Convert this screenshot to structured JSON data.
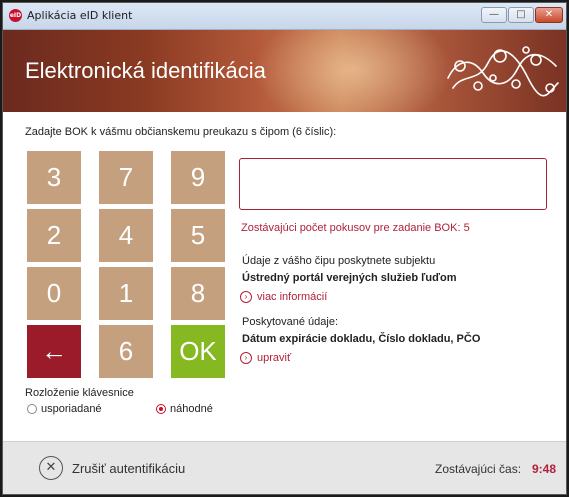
{
  "window": {
    "title": "Aplikácia eID klient",
    "icon_text": "eID",
    "minimize_icon": "minimize-icon",
    "maximize_icon": "maximize-icon",
    "close_icon": "close-icon"
  },
  "banner": {
    "title": "Elektronická identifikácia"
  },
  "instruction": "Zadajte BOK k vášmu občianskemu preukazu s čipom (6 číslic):",
  "keypad": {
    "keys": [
      "3",
      "7",
      "9",
      "2",
      "4",
      "5",
      "0",
      "1",
      "8",
      "←",
      "6",
      "OK"
    ],
    "colors": {
      "digit": "#c4a07f",
      "back": "#9b1b2b",
      "ok": "#86b822"
    }
  },
  "layout": {
    "label": "Rozloženie klávesnice",
    "options": [
      "usporiadané",
      "náhodné"
    ],
    "selected": "náhodné"
  },
  "pin_input": {
    "value": ""
  },
  "attempts_text": "Zostávajúci počet pokusov pre zadanie BOK: 5",
  "subject": {
    "intro": "Údaje z vášho čipu poskytnete subjektu",
    "name": "Ústredný portál verejných služieb ľuďom",
    "more_link": "viac informácií"
  },
  "provided": {
    "label": "Poskytované údaje:",
    "items": "Dátum expirácie dokladu, Číslo dokladu, PČO",
    "edit_link": "upraviť"
  },
  "footer": {
    "cancel_label": "Zrušiť autentifikáciu",
    "time_label": "Zostávajúci čas:",
    "time_value": "9:48"
  },
  "accent": "#b0213b"
}
